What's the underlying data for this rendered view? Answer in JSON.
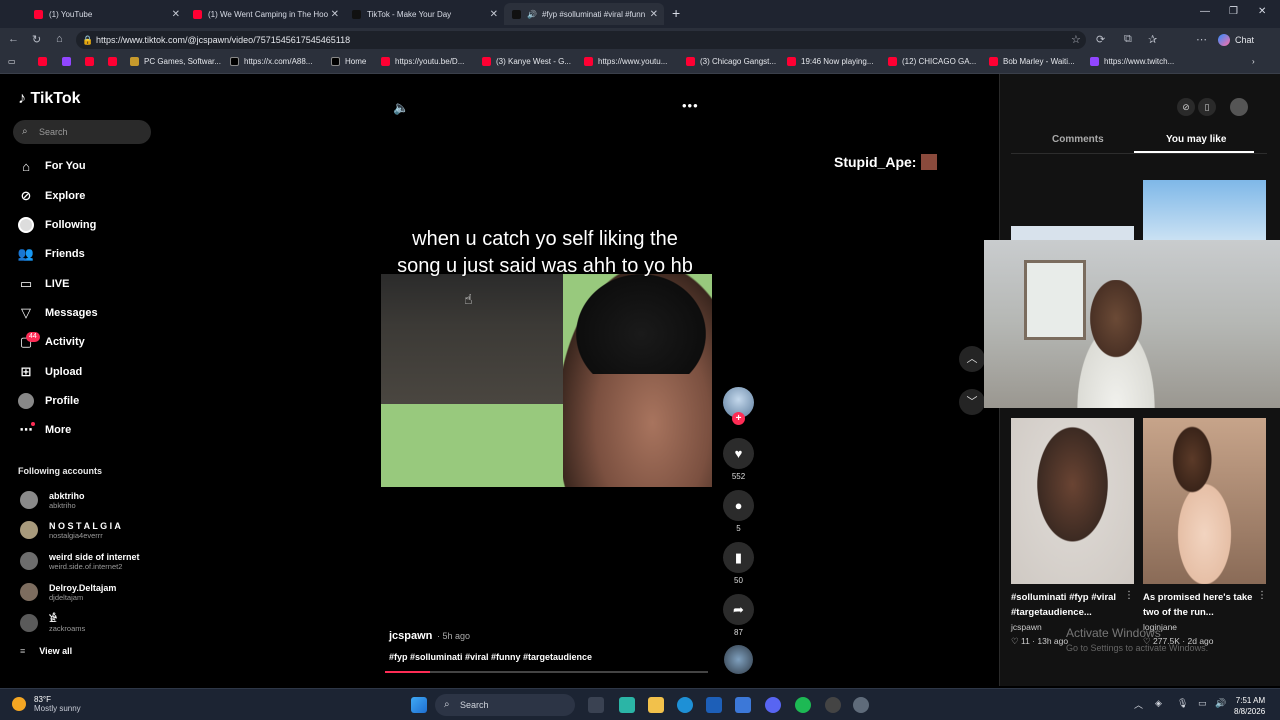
{
  "browser": {
    "tabs": [
      {
        "label": "(1) YouTube"
      },
      {
        "label": "(1) We Went Camping in The Hoo"
      },
      {
        "label": "TikTok - Make Your Day"
      },
      {
        "label": "#fyp #solluminati #viral #funn"
      }
    ],
    "url": "https://www.tiktok.com/@jcspawn/video/7571545617545465118",
    "chat_label": "Chat",
    "bookmarks": [
      "PC Games, Softwar...",
      "https://x.com/A88...",
      "Home",
      "https://youtu.be/D...",
      "(3) Kanye West - G...",
      "https://www.youtu...",
      "(3) Chicago Gangst...",
      "19:46 Now playing...",
      "(12) CHICAGO GA...",
      "Bob Marley - Waiti...",
      "https://www.twitch..."
    ]
  },
  "tiktok": {
    "logo": "TikTok",
    "search_placeholder": "Search",
    "nav": {
      "for_you": "For You",
      "explore": "Explore",
      "following": "Following",
      "friends": "Friends",
      "live": "LIVE",
      "messages": "Messages",
      "activity": "Activity",
      "activity_badge": "44",
      "upload": "Upload",
      "profile": "Profile",
      "more": "More"
    },
    "following_title": "Following accounts",
    "accounts": [
      {
        "name": "abktriho",
        "handle": "abktriho"
      },
      {
        "name": "N O S T A L G I A",
        "handle": "nostalgia4everrr"
      },
      {
        "name": "weird side of internet",
        "handle": "weird.side.of.internet2"
      },
      {
        "name": "Delroy.Deltajam",
        "handle": "djdeltajam"
      },
      {
        "name": "𓀀",
        "handle": "zackroams"
      }
    ],
    "view_all": "View all"
  },
  "video": {
    "caption": "when u catch yo self liking the song u just said was ahh to yo hb",
    "watermark": "Stupid_Ape:",
    "author": "jcspawn",
    "time": " · 5h ago",
    "tags": "#fyp #solluminati #viral #funny #targetaudience",
    "progress": 0.14,
    "likes": "552",
    "comments": "5",
    "saves": "50",
    "shares": "87"
  },
  "right_panel": {
    "tab_comments": "Comments",
    "tab_you_may_like": "You may like",
    "cards": [
      {
        "caption": "#solluminati #fyp #viral #targetaudience...",
        "user": "jcspawn",
        "likes": "11",
        "ago": "13h ago"
      },
      {
        "caption": "As promised here's take two of the run...",
        "user": "loginjane",
        "likes": "277.5K",
        "ago": "2d ago"
      }
    ],
    "activate_title": "Activate Windows",
    "activate_sub": "Go to Settings to activate Windows."
  },
  "taskbar": {
    "temp": "83°F",
    "weather": "Mostly sunny",
    "search": "Search",
    "time": "7:51 AM",
    "date": "8/8/2026"
  },
  "colors": {
    "accent": "#fe2c55",
    "panel": "#121212"
  }
}
